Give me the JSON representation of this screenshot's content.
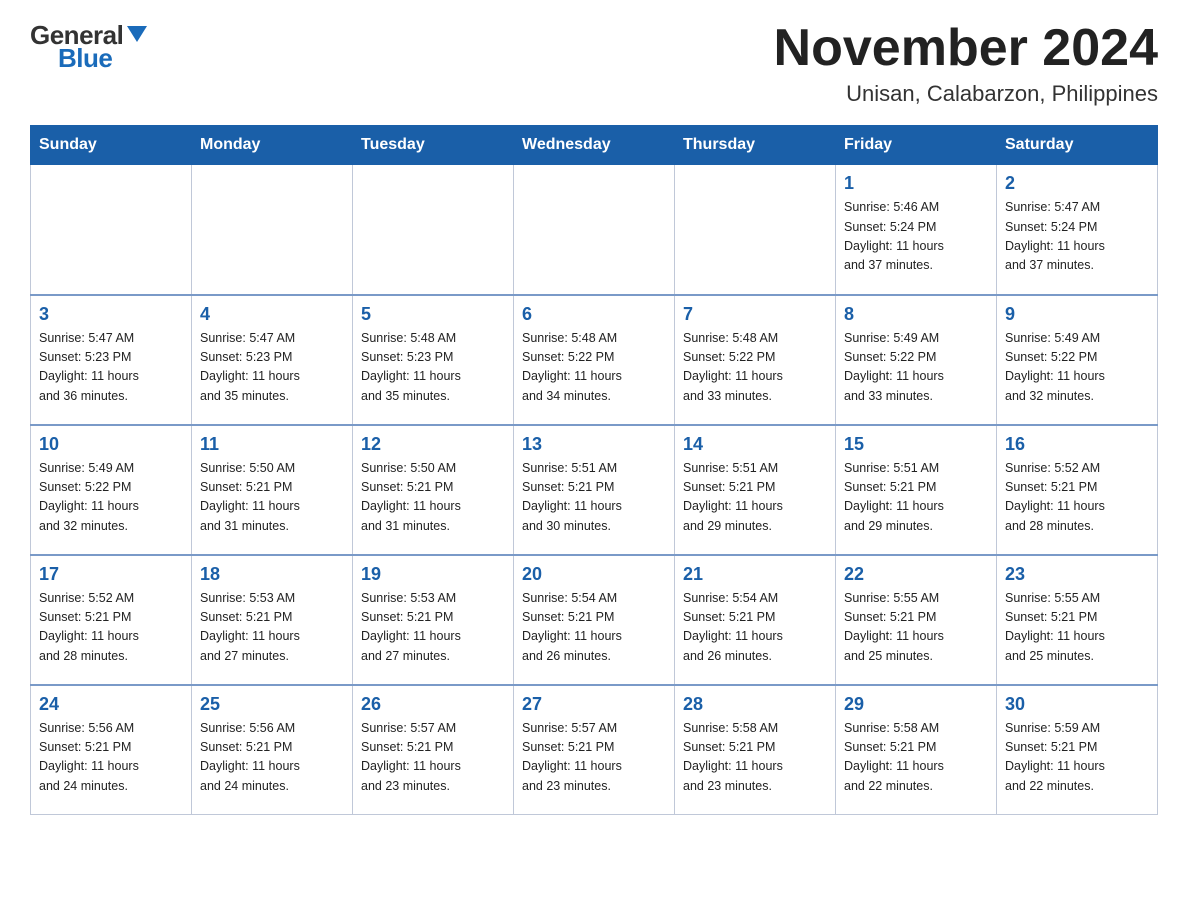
{
  "header": {
    "logo_general": "General",
    "logo_blue": "Blue",
    "title": "November 2024",
    "subtitle": "Unisan, Calabarzon, Philippines"
  },
  "weekdays": [
    "Sunday",
    "Monday",
    "Tuesday",
    "Wednesday",
    "Thursday",
    "Friday",
    "Saturday"
  ],
  "weeks": [
    [
      {
        "day": "",
        "info": ""
      },
      {
        "day": "",
        "info": ""
      },
      {
        "day": "",
        "info": ""
      },
      {
        "day": "",
        "info": ""
      },
      {
        "day": "",
        "info": ""
      },
      {
        "day": "1",
        "info": "Sunrise: 5:46 AM\nSunset: 5:24 PM\nDaylight: 11 hours\nand 37 minutes."
      },
      {
        "day": "2",
        "info": "Sunrise: 5:47 AM\nSunset: 5:24 PM\nDaylight: 11 hours\nand 37 minutes."
      }
    ],
    [
      {
        "day": "3",
        "info": "Sunrise: 5:47 AM\nSunset: 5:23 PM\nDaylight: 11 hours\nand 36 minutes."
      },
      {
        "day": "4",
        "info": "Sunrise: 5:47 AM\nSunset: 5:23 PM\nDaylight: 11 hours\nand 35 minutes."
      },
      {
        "day": "5",
        "info": "Sunrise: 5:48 AM\nSunset: 5:23 PM\nDaylight: 11 hours\nand 35 minutes."
      },
      {
        "day": "6",
        "info": "Sunrise: 5:48 AM\nSunset: 5:22 PM\nDaylight: 11 hours\nand 34 minutes."
      },
      {
        "day": "7",
        "info": "Sunrise: 5:48 AM\nSunset: 5:22 PM\nDaylight: 11 hours\nand 33 minutes."
      },
      {
        "day": "8",
        "info": "Sunrise: 5:49 AM\nSunset: 5:22 PM\nDaylight: 11 hours\nand 33 minutes."
      },
      {
        "day": "9",
        "info": "Sunrise: 5:49 AM\nSunset: 5:22 PM\nDaylight: 11 hours\nand 32 minutes."
      }
    ],
    [
      {
        "day": "10",
        "info": "Sunrise: 5:49 AM\nSunset: 5:22 PM\nDaylight: 11 hours\nand 32 minutes."
      },
      {
        "day": "11",
        "info": "Sunrise: 5:50 AM\nSunset: 5:21 PM\nDaylight: 11 hours\nand 31 minutes."
      },
      {
        "day": "12",
        "info": "Sunrise: 5:50 AM\nSunset: 5:21 PM\nDaylight: 11 hours\nand 31 minutes."
      },
      {
        "day": "13",
        "info": "Sunrise: 5:51 AM\nSunset: 5:21 PM\nDaylight: 11 hours\nand 30 minutes."
      },
      {
        "day": "14",
        "info": "Sunrise: 5:51 AM\nSunset: 5:21 PM\nDaylight: 11 hours\nand 29 minutes."
      },
      {
        "day": "15",
        "info": "Sunrise: 5:51 AM\nSunset: 5:21 PM\nDaylight: 11 hours\nand 29 minutes."
      },
      {
        "day": "16",
        "info": "Sunrise: 5:52 AM\nSunset: 5:21 PM\nDaylight: 11 hours\nand 28 minutes."
      }
    ],
    [
      {
        "day": "17",
        "info": "Sunrise: 5:52 AM\nSunset: 5:21 PM\nDaylight: 11 hours\nand 28 minutes."
      },
      {
        "day": "18",
        "info": "Sunrise: 5:53 AM\nSunset: 5:21 PM\nDaylight: 11 hours\nand 27 minutes."
      },
      {
        "day": "19",
        "info": "Sunrise: 5:53 AM\nSunset: 5:21 PM\nDaylight: 11 hours\nand 27 minutes."
      },
      {
        "day": "20",
        "info": "Sunrise: 5:54 AM\nSunset: 5:21 PM\nDaylight: 11 hours\nand 26 minutes."
      },
      {
        "day": "21",
        "info": "Sunrise: 5:54 AM\nSunset: 5:21 PM\nDaylight: 11 hours\nand 26 minutes."
      },
      {
        "day": "22",
        "info": "Sunrise: 5:55 AM\nSunset: 5:21 PM\nDaylight: 11 hours\nand 25 minutes."
      },
      {
        "day": "23",
        "info": "Sunrise: 5:55 AM\nSunset: 5:21 PM\nDaylight: 11 hours\nand 25 minutes."
      }
    ],
    [
      {
        "day": "24",
        "info": "Sunrise: 5:56 AM\nSunset: 5:21 PM\nDaylight: 11 hours\nand 24 minutes."
      },
      {
        "day": "25",
        "info": "Sunrise: 5:56 AM\nSunset: 5:21 PM\nDaylight: 11 hours\nand 24 minutes."
      },
      {
        "day": "26",
        "info": "Sunrise: 5:57 AM\nSunset: 5:21 PM\nDaylight: 11 hours\nand 23 minutes."
      },
      {
        "day": "27",
        "info": "Sunrise: 5:57 AM\nSunset: 5:21 PM\nDaylight: 11 hours\nand 23 minutes."
      },
      {
        "day": "28",
        "info": "Sunrise: 5:58 AM\nSunset: 5:21 PM\nDaylight: 11 hours\nand 23 minutes."
      },
      {
        "day": "29",
        "info": "Sunrise: 5:58 AM\nSunset: 5:21 PM\nDaylight: 11 hours\nand 22 minutes."
      },
      {
        "day": "30",
        "info": "Sunrise: 5:59 AM\nSunset: 5:21 PM\nDaylight: 11 hours\nand 22 minutes."
      }
    ]
  ]
}
